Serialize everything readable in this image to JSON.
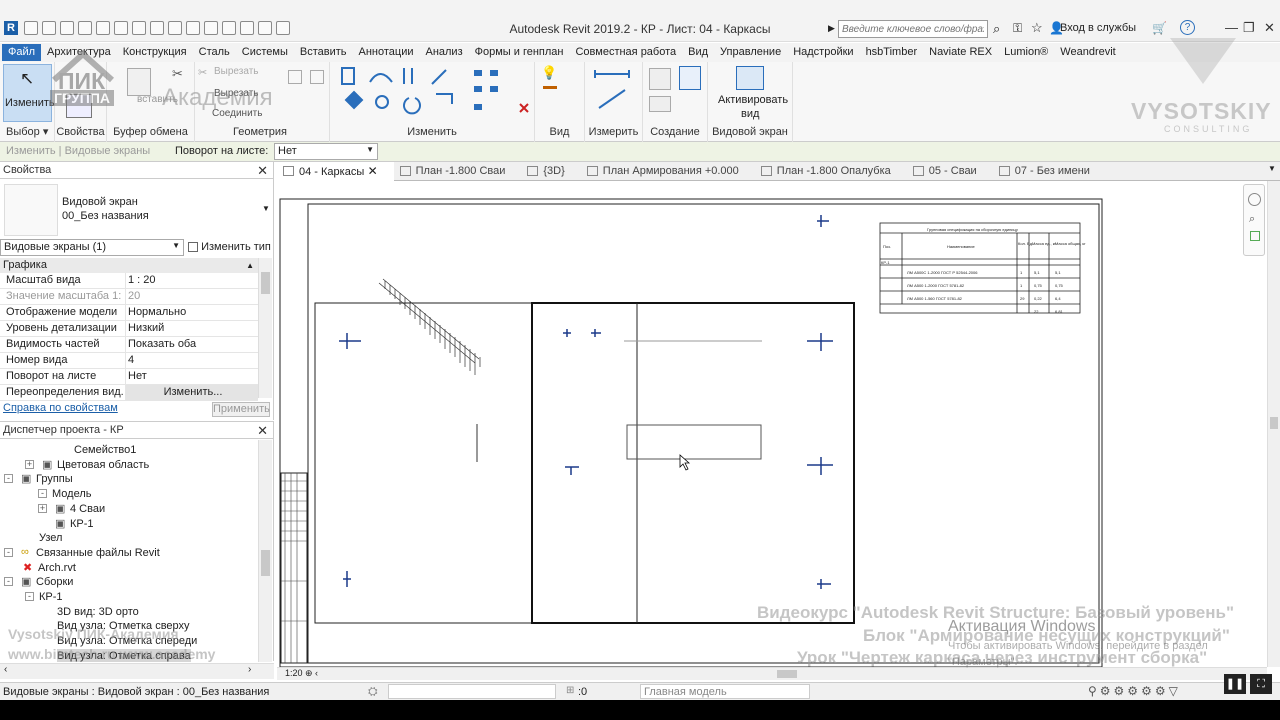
{
  "titlebar": {
    "app_title": "Autodesk Revit 2019.2 - КР - Лист: 04 - Каркасы",
    "search_placeholder": "Введите ключевое слово/фразу",
    "signin": "Вход в службы"
  },
  "ribbon_tabs": [
    "Файл",
    "Архитектура",
    "Конструкция",
    "Сталь",
    "Системы",
    "Вставить",
    "Аннотации",
    "Анализ",
    "Формы и генплан",
    "Совместная работа",
    "Вид",
    "Управление",
    "Надстройки",
    "hsbTimber",
    "Naviate REX",
    "Lumion®",
    "Weandrevit"
  ],
  "ribbon": {
    "modify_label": "Изменить",
    "cut_label": "Вырезать",
    "cut_label2": "Вырезать",
    "join_label": "Соединить",
    "activate_label": "Активировать",
    "activate_label2": "вид",
    "groups": [
      "Выбор",
      "Свойства",
      "Буфер обмена",
      "Геометрия",
      "Изменить",
      "Вид",
      "Измерить",
      "Создание",
      "Видовой экран"
    ]
  },
  "optbar": {
    "context": "Изменить | Видовые экраны",
    "rotation_label": "Поворот на листе:",
    "rotation_value": "Нет"
  },
  "viewtabs": [
    {
      "label": "04 - Каркасы",
      "active": true
    },
    {
      "label": "План -1.800 Сваи",
      "active": false
    },
    {
      "label": "{3D}",
      "active": false
    },
    {
      "label": "План Армирования +0.000",
      "active": false
    },
    {
      "label": "План -1.800 Опалубка",
      "active": false
    },
    {
      "label": "05 - Сваи",
      "active": false
    },
    {
      "label": "07 - Без имени",
      "active": false
    }
  ],
  "properties": {
    "title": "Свойства",
    "type_line1": "Видовой экран",
    "type_line2": "00_Без названия",
    "selector": "Видовые экраны (1)",
    "edit_type": "Изменить тип",
    "section": "Графика",
    "rows": [
      {
        "k": "Масштаб вида",
        "v": "1 : 20",
        "grey": false
      },
      {
        "k": "Значение масштаба    1:",
        "v": "20",
        "grey": true
      },
      {
        "k": "Отображение модели",
        "v": "Нормально",
        "grey": false
      },
      {
        "k": "Уровень детализации",
        "v": "Низкий",
        "grey": false
      },
      {
        "k": "Видимость частей",
        "v": "Показать оба",
        "grey": false
      },
      {
        "k": "Номер вида",
        "v": "4",
        "grey": false
      },
      {
        "k": "Поворот на листе",
        "v": "Нет",
        "grey": false
      },
      {
        "k": "Переопределения вид...",
        "v": "Изменить...",
        "grey": false
      }
    ],
    "help_link": "Справка по свойствам",
    "apply": "Применить"
  },
  "project_browser": {
    "title": "Диспетчер проекта - КР",
    "rows": [
      "Семейство1",
      "Цветовая область",
      "Группы",
      "Модель",
      "4 Сваи",
      "КР-1",
      "Узел",
      "Связанные файлы Revit",
      "Arch.rvt",
      "Сборки",
      "КР-1",
      "3D вид: 3D орто",
      "Вид узла: Отметка сверху",
      "Вид узла: Отметка спереди",
      "Вид узла: Отметка справа"
    ]
  },
  "schedule": {
    "title": "Групповая спецификация на сборочную единицу",
    "h1": "Поз.",
    "h2": "Наименование",
    "h3": "Кол. Ед.",
    "h4": "Масса ед., кг",
    "h5": "Масса общая, кг",
    "group": "КР-1",
    "rows": [
      [
        "",
        "ЛМ А500С  1-2000  ГОСТ Р 52544-2006",
        "1",
        "5,1",
        "5,1"
      ],
      [
        "",
        "ЛМ А500  1-2000  ГОСТ 5781-82",
        "1",
        "0,75",
        "0,75"
      ],
      [
        "",
        "ЛМ А500  1-560  ГОСТ 5781-82",
        "29",
        "0,22",
        "6,4"
      ],
      [
        "",
        "",
        "",
        "22",
        "6,81"
      ]
    ]
  },
  "statusbar": {
    "text": "Видовые экраны : Видовой экран : 00_Без названия",
    "zero": ":0",
    "model": "Главная модель"
  },
  "watermarks": {
    "logo_top": "ПИК",
    "logo_group": "ГРУППА",
    "academy": "Академия",
    "brand": "VYSOTSKIY",
    "brand_sub": "CONSULTING",
    "course1": "Видеокурс \"Autodesk Revit Structure: Базовый уровень\"",
    "course2": "Блок \"Армирование несущих конструкций\"",
    "course3": "Урок \"Чертеж каркаса через инструмент сборка\"",
    "activation": "Активация Windows",
    "activation_sub": "Чтобы активировать Windows, перейдите в раздел",
    "activation_sub2": "\"Параметры\".",
    "left1": "Vysotskiy ПИК-Академия",
    "left2": "www.bimtech.ru www.academy"
  }
}
